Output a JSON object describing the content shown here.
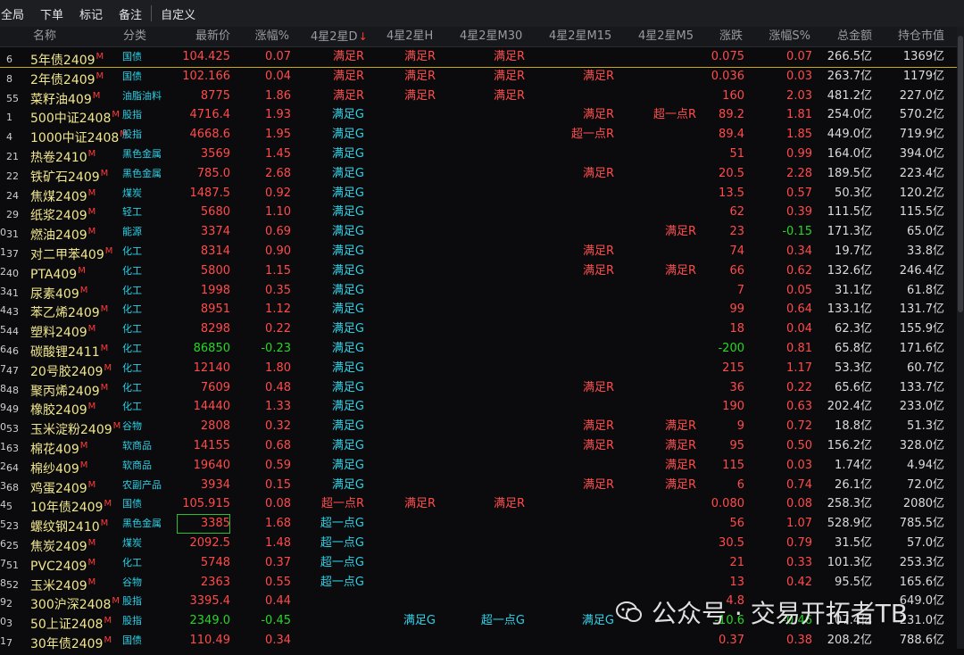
{
  "toolbar": [
    "全局",
    "下单",
    "标记",
    "备注",
    "自定义"
  ],
  "columns": {
    "name": "名称",
    "category": "分类",
    "price": "最新价",
    "change_pct": "涨幅%",
    "sig_d": "4星2星D",
    "sig_h": "4星2星H",
    "sig_m30": "4星2星M30",
    "sig_m15": "4星2星M15",
    "sig_m5": "4星2星M5",
    "diff": "涨跌",
    "s_pct": "涨幅S%",
    "amount": "总金额",
    "oi_value": "持仓市值"
  },
  "sort_arrow": "↓",
  "rows": [
    {
      "a": "",
      "b": "6",
      "name": "5年债2409",
      "cat": "国债",
      "price": "104.425",
      "pc": "red",
      "chg": "0.07",
      "cc": "red",
      "d": "满足R",
      "dc": "red",
      "h": "满足R",
      "hc": "red",
      "m30": "满足R",
      "m30c": "red",
      "m15": "",
      "m15c": "",
      "m5": "",
      "m5c": "",
      "diff": "0.075",
      "diffc": "red",
      "s": "0.07",
      "sc": "red",
      "amt": "266.5亿",
      "oi": "1369亿",
      "sel": true
    },
    {
      "a": "",
      "b": "8",
      "name": "2年债2409",
      "cat": "国债",
      "price": "102.166",
      "pc": "red",
      "chg": "0.04",
      "cc": "red",
      "d": "满足R",
      "dc": "red",
      "h": "满足R",
      "hc": "red",
      "m30": "满足R",
      "m30c": "red",
      "m15": "满足R",
      "m15c": "red",
      "m5": "",
      "m5c": "",
      "diff": "0.036",
      "diffc": "red",
      "s": "0.03",
      "sc": "red",
      "amt": "263.7亿",
      "oi": "1179亿"
    },
    {
      "a": "",
      "b": "55",
      "name": "菜籽油409",
      "cat": "油脂油料",
      "price": "8775",
      "pc": "red",
      "chg": "1.86",
      "cc": "red",
      "d": "满足R",
      "dc": "red",
      "h": "满足R",
      "hc": "red",
      "m30": "满足R",
      "m30c": "red",
      "m15": "",
      "m15c": "",
      "m5": "",
      "m5c": "",
      "diff": "160",
      "diffc": "red",
      "s": "2.03",
      "sc": "red",
      "amt": "481.2亿",
      "oi": "227.0亿"
    },
    {
      "a": "",
      "b": "1",
      "name": "500中证2408",
      "cat": "股指",
      "price": "4716.4",
      "pc": "red",
      "chg": "1.93",
      "cc": "red",
      "d": "满足G",
      "dc": "cyan",
      "h": "",
      "hc": "",
      "m30": "",
      "m30c": "",
      "m15": "满足R",
      "m15c": "red",
      "m5": "超一点R",
      "m5c": "red",
      "diff": "89.2",
      "diffc": "red",
      "s": "1.81",
      "sc": "red",
      "amt": "254.0亿",
      "oi": "570.2亿"
    },
    {
      "a": "",
      "b": "4",
      "name": "1000中证2408",
      "cat": "股指",
      "price": "4668.6",
      "pc": "red",
      "chg": "1.95",
      "cc": "red",
      "d": "满足G",
      "dc": "cyan",
      "h": "",
      "hc": "",
      "m30": "",
      "m30c": "",
      "m15": "超一点R",
      "m15c": "red",
      "m5": "",
      "m5c": "",
      "diff": "89.4",
      "diffc": "red",
      "s": "1.85",
      "sc": "red",
      "amt": "449.0亿",
      "oi": "719.9亿"
    },
    {
      "a": "",
      "b": "21",
      "name": "热卷2410",
      "cat": "黑色金属",
      "price": "3569",
      "pc": "red",
      "chg": "1.45",
      "cc": "red",
      "d": "满足G",
      "dc": "cyan",
      "h": "",
      "hc": "",
      "m30": "",
      "m30c": "",
      "m15": "",
      "m15c": "",
      "m5": "",
      "m5c": "",
      "diff": "51",
      "diffc": "red",
      "s": "0.99",
      "sc": "red",
      "amt": "164.0亿",
      "oi": "394.0亿"
    },
    {
      "a": "",
      "b": "22",
      "name": "铁矿石2409",
      "cat": "黑色金属",
      "price": "785.0",
      "pc": "red",
      "chg": "2.68",
      "cc": "red",
      "d": "满足G",
      "dc": "cyan",
      "h": "",
      "hc": "",
      "m30": "",
      "m30c": "",
      "m15": "满足R",
      "m15c": "red",
      "m5": "",
      "m5c": "",
      "diff": "20.5",
      "diffc": "red",
      "s": "2.28",
      "sc": "red",
      "amt": "189.5亿",
      "oi": "223.4亿"
    },
    {
      "a": "",
      "b": "24",
      "name": "焦煤2409",
      "cat": "煤炭",
      "price": "1487.5",
      "pc": "red",
      "chg": "0.92",
      "cc": "red",
      "d": "满足G",
      "dc": "cyan",
      "h": "",
      "hc": "",
      "m30": "",
      "m30c": "",
      "m15": "",
      "m15c": "",
      "m5": "",
      "m5c": "",
      "diff": "13.5",
      "diffc": "red",
      "s": "0.57",
      "sc": "red",
      "amt": "50.3亿",
      "oi": "120.2亿"
    },
    {
      "a": "",
      "b": "29",
      "name": "纸浆2409",
      "cat": "轻工",
      "price": "5680",
      "pc": "red",
      "chg": "1.10",
      "cc": "red",
      "d": "满足G",
      "dc": "cyan",
      "h": "",
      "hc": "",
      "m30": "",
      "m30c": "",
      "m15": "",
      "m15c": "",
      "m5": "",
      "m5c": "",
      "diff": "62",
      "diffc": "red",
      "s": "0.39",
      "sc": "red",
      "amt": "111.5亿",
      "oi": "115.5亿"
    },
    {
      "a": "0",
      "b": "31",
      "name": "燃油2409",
      "cat": "能源",
      "price": "3374",
      "pc": "red",
      "chg": "0.69",
      "cc": "red",
      "d": "满足G",
      "dc": "cyan",
      "h": "",
      "hc": "",
      "m30": "",
      "m30c": "",
      "m15": "",
      "m15c": "",
      "m5": "满足R",
      "m5c": "red",
      "diff": "23",
      "diffc": "red",
      "s": "-0.15",
      "sc": "green",
      "amt": "171.3亿",
      "oi": "65.0亿"
    },
    {
      "a": "1",
      "b": "37",
      "name": "对二甲苯409",
      "cat": "化工",
      "price": "8314",
      "pc": "red",
      "chg": "0.90",
      "cc": "red",
      "d": "满足G",
      "dc": "cyan",
      "h": "",
      "hc": "",
      "m30": "",
      "m30c": "",
      "m15": "满足R",
      "m15c": "red",
      "m5": "",
      "m5c": "",
      "diff": "74",
      "diffc": "red",
      "s": "0.34",
      "sc": "red",
      "amt": "19.7亿",
      "oi": "33.8亿"
    },
    {
      "a": "2",
      "b": "40",
      "name": "PTA409",
      "cat": "化工",
      "price": "5800",
      "pc": "red",
      "chg": "1.15",
      "cc": "red",
      "d": "满足G",
      "dc": "cyan",
      "h": "",
      "hc": "",
      "m30": "",
      "m30c": "",
      "m15": "满足R",
      "m15c": "red",
      "m5": "满足R",
      "m5c": "red",
      "diff": "66",
      "diffc": "red",
      "s": "0.62",
      "sc": "red",
      "amt": "132.6亿",
      "oi": "246.4亿"
    },
    {
      "a": "3",
      "b": "41",
      "name": "尿素409",
      "cat": "化工",
      "price": "1998",
      "pc": "red",
      "chg": "0.35",
      "cc": "red",
      "d": "满足G",
      "dc": "cyan",
      "h": "",
      "hc": "",
      "m30": "",
      "m30c": "",
      "m15": "",
      "m15c": "",
      "m5": "",
      "m5c": "",
      "diff": "7",
      "diffc": "red",
      "s": "0.05",
      "sc": "red",
      "amt": "31.1亿",
      "oi": "61.8亿"
    },
    {
      "a": "4",
      "b": "43",
      "name": "苯乙烯2409",
      "cat": "化工",
      "price": "8951",
      "pc": "red",
      "chg": "1.12",
      "cc": "red",
      "d": "满足G",
      "dc": "cyan",
      "h": "",
      "hc": "",
      "m30": "",
      "m30c": "",
      "m15": "",
      "m15c": "",
      "m5": "",
      "m5c": "",
      "diff": "99",
      "diffc": "red",
      "s": "0.64",
      "sc": "red",
      "amt": "133.1亿",
      "oi": "131.7亿"
    },
    {
      "a": "5",
      "b": "44",
      "name": "塑料2409",
      "cat": "化工",
      "price": "8298",
      "pc": "red",
      "chg": "0.22",
      "cc": "red",
      "d": "满足G",
      "dc": "cyan",
      "h": "",
      "hc": "",
      "m30": "",
      "m30c": "",
      "m15": "",
      "m15c": "",
      "m5": "",
      "m5c": "",
      "diff": "18",
      "diffc": "red",
      "s": "0.04",
      "sc": "red",
      "amt": "62.3亿",
      "oi": "155.9亿"
    },
    {
      "a": "6",
      "b": "46",
      "name": "碳酸锂2411",
      "cat": "化工",
      "price": "86850",
      "pc": "green",
      "chg": "-0.23",
      "cc": "green",
      "d": "满足G",
      "dc": "cyan",
      "h": "",
      "hc": "",
      "m30": "",
      "m30c": "",
      "m15": "",
      "m15c": "",
      "m5": "",
      "m5c": "",
      "diff": "-200",
      "diffc": "green",
      "s": "0.81",
      "sc": "red",
      "amt": "65.8亿",
      "oi": "171.6亿"
    },
    {
      "a": "7",
      "b": "47",
      "name": "20号胶2409",
      "cat": "化工",
      "price": "12140",
      "pc": "red",
      "chg": "1.80",
      "cc": "red",
      "d": "满足G",
      "dc": "cyan",
      "h": "",
      "hc": "",
      "m30": "",
      "m30c": "",
      "m15": "",
      "m15c": "",
      "m5": "",
      "m5c": "",
      "diff": "215",
      "diffc": "red",
      "s": "1.17",
      "sc": "red",
      "amt": "53.3亿",
      "oi": "60.7亿"
    },
    {
      "a": "8",
      "b": "48",
      "name": "聚丙烯2409",
      "cat": "化工",
      "price": "7609",
      "pc": "red",
      "chg": "0.48",
      "cc": "red",
      "d": "满足G",
      "dc": "cyan",
      "h": "",
      "hc": "",
      "m30": "",
      "m30c": "",
      "m15": "满足R",
      "m15c": "red",
      "m5": "",
      "m5c": "",
      "diff": "36",
      "diffc": "red",
      "s": "0.22",
      "sc": "red",
      "amt": "65.6亿",
      "oi": "133.7亿"
    },
    {
      "a": "9",
      "b": "49",
      "name": "橡胶2409",
      "cat": "化工",
      "price": "14440",
      "pc": "red",
      "chg": "1.33",
      "cc": "red",
      "d": "满足G",
      "dc": "cyan",
      "h": "",
      "hc": "",
      "m30": "",
      "m30c": "",
      "m15": "",
      "m15c": "",
      "m5": "",
      "m5c": "",
      "diff": "190",
      "diffc": "red",
      "s": "0.63",
      "sc": "red",
      "amt": "202.4亿",
      "oi": "233.0亿"
    },
    {
      "a": "0",
      "b": "53",
      "name": "玉米淀粉2409",
      "cat": "谷物",
      "price": "2808",
      "pc": "red",
      "chg": "0.32",
      "cc": "red",
      "d": "满足G",
      "dc": "cyan",
      "h": "",
      "hc": "",
      "m30": "",
      "m30c": "",
      "m15": "满足R",
      "m15c": "red",
      "m5": "满足R",
      "m5c": "red",
      "diff": "9",
      "diffc": "red",
      "s": "0.72",
      "sc": "red",
      "amt": "18.8亿",
      "oi": "51.3亿"
    },
    {
      "a": "1",
      "b": "63",
      "name": "棉花409",
      "cat": "软商品",
      "price": "14155",
      "pc": "red",
      "chg": "0.68",
      "cc": "red",
      "d": "满足G",
      "dc": "cyan",
      "h": "",
      "hc": "",
      "m30": "",
      "m30c": "",
      "m15": "满足R",
      "m15c": "red",
      "m5": "满足R",
      "m5c": "red",
      "diff": "95",
      "diffc": "red",
      "s": "0.50",
      "sc": "red",
      "amt": "156.2亿",
      "oi": "328.0亿"
    },
    {
      "a": "2",
      "b": "64",
      "name": "棉纱409",
      "cat": "软商品",
      "price": "19640",
      "pc": "red",
      "chg": "0.59",
      "cc": "red",
      "d": "满足G",
      "dc": "cyan",
      "h": "",
      "hc": "",
      "m30": "",
      "m30c": "",
      "m15": "",
      "m15c": "",
      "m5": "满足R",
      "m5c": "red",
      "diff": "115",
      "diffc": "red",
      "s": "0.03",
      "sc": "red",
      "amt": "1.74亿",
      "oi": "4.94亿"
    },
    {
      "a": "3",
      "b": "68",
      "name": "鸡蛋2409",
      "cat": "农副产品",
      "price": "3934",
      "pc": "red",
      "chg": "0.15",
      "cc": "red",
      "d": "满足G",
      "dc": "cyan",
      "h": "",
      "hc": "",
      "m30": "",
      "m30c": "",
      "m15": "满足R",
      "m15c": "red",
      "m5": "满足R",
      "m5c": "red",
      "diff": "6",
      "diffc": "red",
      "s": "0.74",
      "sc": "red",
      "amt": "26.1亿",
      "oi": "72.0亿"
    },
    {
      "a": "4",
      "b": "5",
      "name": "10年债2409",
      "cat": "国债",
      "price": "105.915",
      "pc": "red",
      "chg": "0.08",
      "cc": "red",
      "d": "超一点R",
      "dc": "red",
      "h": "满足R",
      "hc": "red",
      "m30": "满足R",
      "m30c": "red",
      "m15": "",
      "m15c": "",
      "m5": "",
      "m5c": "",
      "diff": "0.080",
      "diffc": "red",
      "s": "0.08",
      "sc": "red",
      "amt": "258.3亿",
      "oi": "2080亿"
    },
    {
      "a": "5",
      "b": "23",
      "name": "螺纹钢2410",
      "cat": "黑色金属",
      "price": "3385",
      "pc": "red",
      "chg": "1.68",
      "cc": "red",
      "d": "超一点G",
      "dc": "cyan",
      "h": "",
      "hc": "",
      "m30": "",
      "m30c": "",
      "m15": "",
      "m15c": "",
      "m5": "",
      "m5c": "",
      "diff": "56",
      "diffc": "red",
      "s": "1.07",
      "sc": "red",
      "amt": "528.9亿",
      "oi": "785.5亿",
      "boxed": true
    },
    {
      "a": "6",
      "b": "25",
      "name": "焦炭2409",
      "cat": "煤炭",
      "price": "2092.5",
      "pc": "red",
      "chg": "1.48",
      "cc": "red",
      "d": "超一点G",
      "dc": "cyan",
      "h": "",
      "hc": "",
      "m30": "",
      "m30c": "",
      "m15": "",
      "m15c": "",
      "m5": "",
      "m5c": "",
      "diff": "30.5",
      "diffc": "red",
      "s": "0.79",
      "sc": "red",
      "amt": "31.5亿",
      "oi": "57.0亿"
    },
    {
      "a": "7",
      "b": "51",
      "name": "PVC2409",
      "cat": "化工",
      "price": "5748",
      "pc": "red",
      "chg": "0.37",
      "cc": "red",
      "d": "超一点G",
      "dc": "cyan",
      "h": "",
      "hc": "",
      "m30": "",
      "m30c": "",
      "m15": "",
      "m15c": "",
      "m5": "",
      "m5c": "",
      "diff": "21",
      "diffc": "red",
      "s": "0.33",
      "sc": "red",
      "amt": "101.3亿",
      "oi": "253.3亿"
    },
    {
      "a": "8",
      "b": "52",
      "name": "玉米2409",
      "cat": "谷物",
      "price": "2363",
      "pc": "red",
      "chg": "0.55",
      "cc": "red",
      "d": "超一点G",
      "dc": "cyan",
      "h": "",
      "hc": "",
      "m30": "",
      "m30c": "",
      "m15": "",
      "m15c": "",
      "m5": "",
      "m5c": "",
      "diff": "13",
      "diffc": "red",
      "s": "0.42",
      "sc": "red",
      "amt": "95.5亿",
      "oi": "165.6亿"
    },
    {
      "a": "9",
      "b": "2",
      "name": "300沪深2408",
      "cat": "股指",
      "price": "3395.4",
      "pc": "red",
      "chg": "0.44",
      "cc": "red",
      "d": "",
      "dc": "",
      "h": "",
      "hc": "",
      "m30": "",
      "m30c": "",
      "m15": "",
      "m15c": "",
      "m5": "",
      "m5c": "",
      "diff": "4.8",
      "diffc": "red",
      "s": "",
      "sc": "red",
      "amt": "",
      "oi": "649.0亿"
    },
    {
      "a": "0",
      "b": "3",
      "name": "50上证2408",
      "cat": "股指",
      "price": "2349.0",
      "pc": "green",
      "chg": "-0.45",
      "cc": "green",
      "d": "",
      "dc": "",
      "h": "满足G",
      "hc": "cyan",
      "m30": "超一点G",
      "m30c": "cyan",
      "m15": "满足G",
      "m15c": "cyan",
      "m5": "",
      "m5c": "",
      "diff": "-10.6",
      "diffc": "green",
      "s": "-0.46",
      "sc": "green",
      "amt": "107.4亿",
      "oi": "231.0亿"
    },
    {
      "a": "1",
      "b": "7",
      "name": "30年债2409",
      "cat": "国债",
      "price": "110.49",
      "pc": "red",
      "chg": "0.34",
      "cc": "red",
      "d": "",
      "dc": "",
      "h": "",
      "hc": "",
      "m30": "",
      "m30c": "",
      "m15": "",
      "m15c": "",
      "m5": "",
      "m5c": "",
      "diff": "0.37",
      "diffc": "red",
      "s": "0.38",
      "sc": "red",
      "amt": "208.2亿",
      "oi": "788.6亿"
    }
  ],
  "watermark": {
    "account": "公众号 · 交易开拓者TB"
  },
  "colors": {
    "red": "#ff4b4b",
    "green": "#27d627",
    "cyan": "#29d2e6",
    "name": "#f0e68c",
    "selected_line": "#c7a916"
  }
}
